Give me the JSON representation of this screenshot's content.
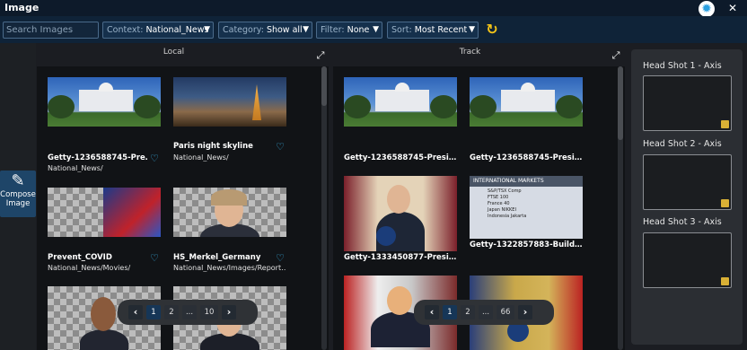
{
  "app": {
    "title": "Image"
  },
  "window_buttons": {
    "theme_icon": "sun-icon",
    "close_glyph": "✕"
  },
  "toolbar": {
    "search_placeholder": "Search Images",
    "context": {
      "key": "Context:",
      "value": "National_News"
    },
    "category": {
      "key": "Category:",
      "value": "Show all"
    },
    "filter": {
      "key": "Filter:",
      "value": "None"
    },
    "sort": {
      "key": "Sort:",
      "value": "Most Recent"
    },
    "refresh_icon": "refresh-icon"
  },
  "left_tool": {
    "label_line1": "Compose",
    "label_line2": "Image"
  },
  "local": {
    "header": "Local",
    "items": [
      {
        "caption": "Getty-1236588745-Pre…",
        "path": "National_News/"
      },
      {
        "caption": "Paris night skyline",
        "path": "National_News/"
      },
      {
        "caption": "Prevent_COVID",
        "path": "National_News/Movies/"
      },
      {
        "caption": "HS_Merkel_Germany",
        "path": "National_News/Images/Report…"
      }
    ],
    "pager": {
      "pages": [
        "1",
        "2",
        "...",
        "10"
      ],
      "current": "1"
    }
  },
  "track": {
    "header": "Track",
    "items": [
      {
        "caption": "Getty-1236588745-Presi…"
      },
      {
        "caption": "Getty-1236588745-Presi…"
      },
      {
        "caption": "Getty-1333450877-Presi…"
      },
      {
        "caption": "Getty-1322857883-Build…"
      }
    ],
    "market_title": "INTERNATIONAL MARKETS",
    "market_rows": [
      "S&P/TSX Comp",
      "FTSE 100",
      "France 40",
      "Japan NIKKEI",
      "Indonesia Jakarta"
    ],
    "pager": {
      "pages": [
        "1",
        "2",
        "...",
        "66"
      ],
      "current": "1"
    }
  },
  "headshots": [
    {
      "label": "Head Shot 1 - Axis"
    },
    {
      "label": "Head Shot 2 - Axis"
    },
    {
      "label": "Head Shot 3 - Axis"
    }
  ],
  "colors": {
    "accent": "#39b3e8",
    "pager_active": "#163657",
    "refresh": "#f5c518"
  }
}
